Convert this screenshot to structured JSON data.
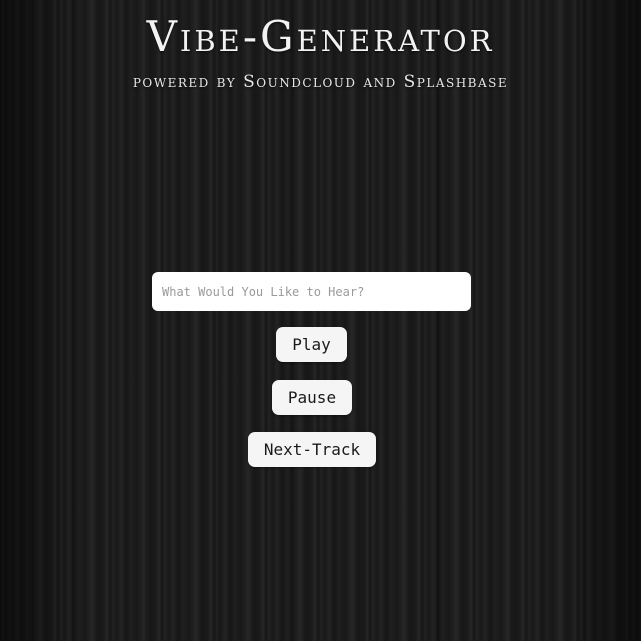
{
  "header": {
    "title": "Vibe-Generator",
    "subtitle": "powered by Soundcloud and Splashbase"
  },
  "search": {
    "placeholder": "What Would You Like to Hear?",
    "value": ""
  },
  "controls": {
    "play_label": "Play",
    "pause_label": "Pause",
    "next_label": "Next-Track"
  },
  "colors": {
    "background": "#1b1b1b",
    "text": "#f2f2f2",
    "button_bg": "#f5f5f5"
  }
}
